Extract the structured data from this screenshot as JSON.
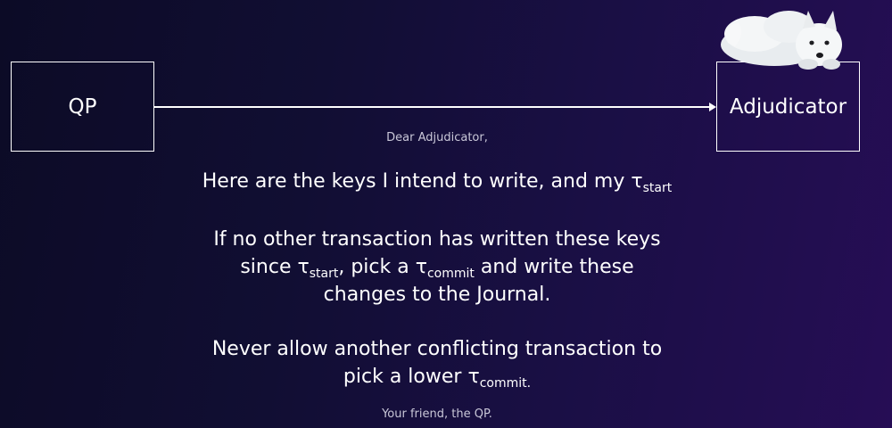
{
  "boxes": {
    "qp": "QP",
    "adjudicator": "Adjudicator"
  },
  "letter": {
    "salutation": "Dear Adjudicator,",
    "line1": {
      "text": "Here are the keys I intend to write, and my τ",
      "sub": "start"
    },
    "para2": {
      "l1": "If no other transaction has written these keys",
      "l2_a": "since τ",
      "l2_sub1": "start",
      "l2_b": ", pick a τ",
      "l2_sub2": "commit",
      "l2_c": " and write these",
      "l3": "changes to the Journal."
    },
    "para3": {
      "l1": "Never allow another conflicting transaction to",
      "l2_a": "pick a lower τ",
      "l2_sub": "commit."
    },
    "signoff": "Your friend, the QP."
  },
  "colors": {
    "background_left": "#0c0b26",
    "background_right": "#260d55",
    "text": "#ffffff",
    "muted_text": "#c9c7d8"
  }
}
